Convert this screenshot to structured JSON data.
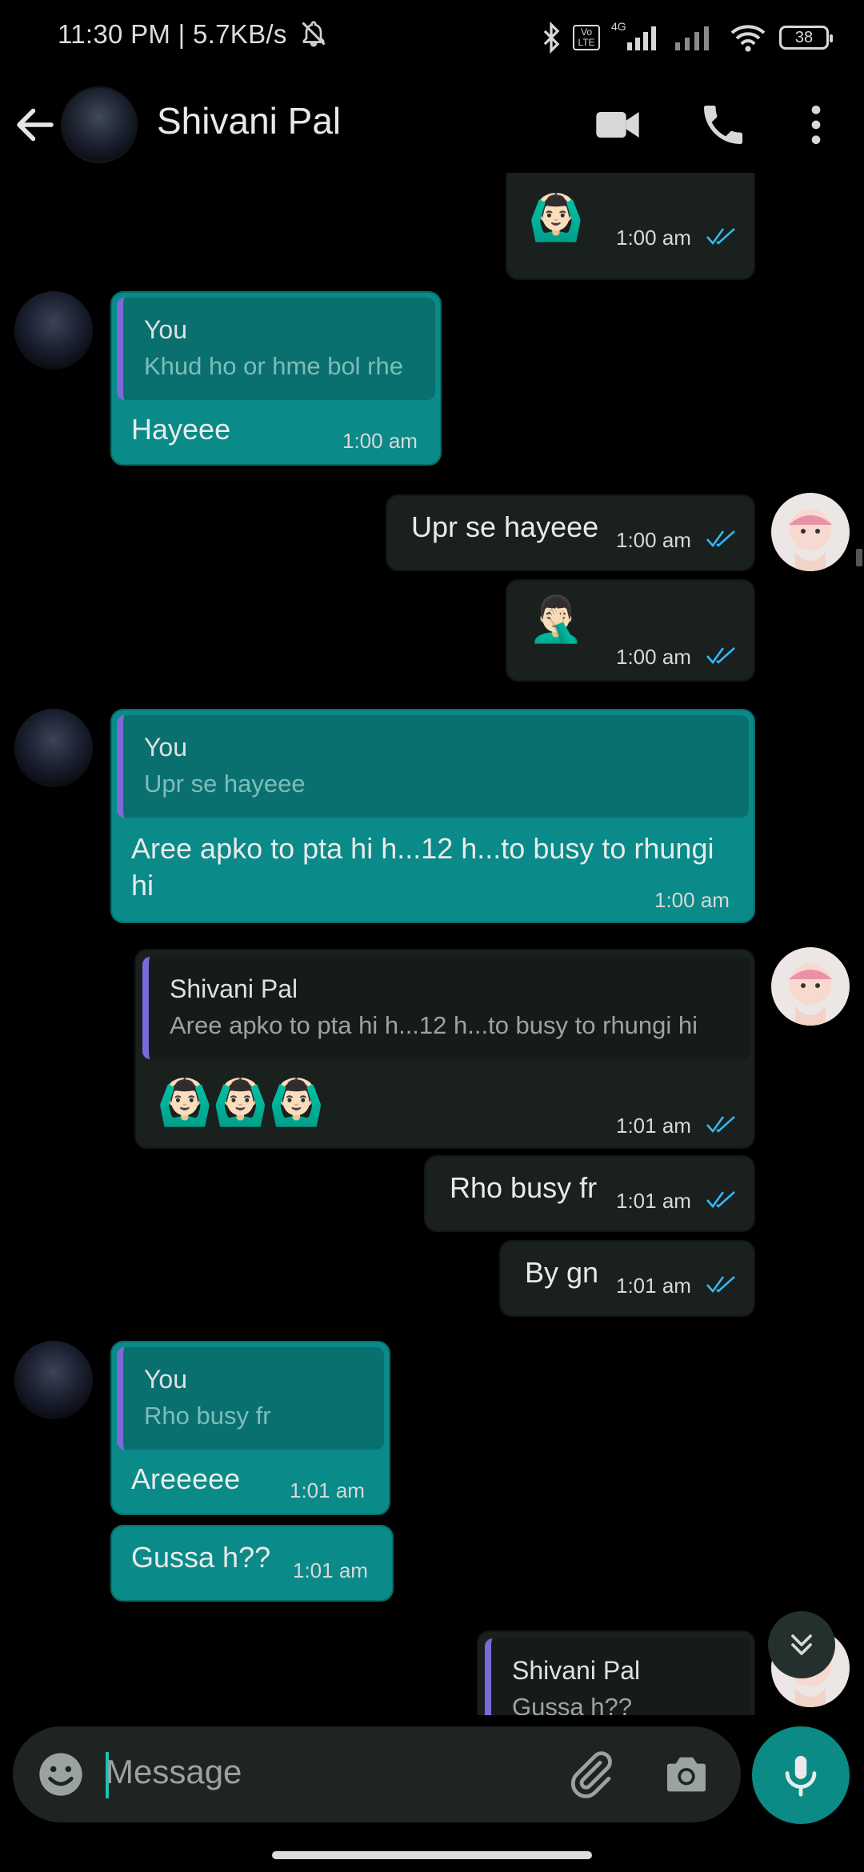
{
  "status_bar": {
    "time_speed": "11:30 PM | 5.7KB/s",
    "network": "4G",
    "volte": "Vo LTE",
    "battery": "38"
  },
  "header": {
    "contact_name": "Shivani Pal"
  },
  "messages": {
    "m1": {
      "time": "1:00 am"
    },
    "m2": {
      "quote_author": "You",
      "quote_text": "Khud ho or hme bol rhe",
      "text": "Hayeee",
      "time": "1:00 am"
    },
    "m3": {
      "text": "Upr se hayeee",
      "time": "1:00 am"
    },
    "m4": {
      "time": "1:00 am"
    },
    "m5": {
      "quote_author": "You",
      "quote_text": "Upr se hayeee",
      "text_line1": "Aree apko to pta hi h...12 h...to busy to rhungi",
      "text_line2": "hi",
      "time": "1:00 am"
    },
    "m6": {
      "quote_author": "Shivani Pal",
      "quote_text": "Aree apko to pta hi h...12 h...to busy to rhungi hi",
      "time": "1:01 am"
    },
    "m7": {
      "text": "Rho busy fr",
      "time": "1:01 am"
    },
    "m8": {
      "text": "By gn",
      "time": "1:01 am"
    },
    "m9": {
      "quote_author": "You",
      "quote_text": "Rho busy fr",
      "text": "Areeeee",
      "time": "1:01 am"
    },
    "m10": {
      "text": "Gussa h??",
      "time": "1:01 am"
    },
    "m11": {
      "quote_author": "Shivani Pal",
      "quote_text": "Gussa h??"
    }
  },
  "input": {
    "placeholder": "Message"
  },
  "colors": {
    "incoming_bubble": "#0a8a89",
    "outgoing_bubble": "#1a201e",
    "quote_bar": "#7b6ad8",
    "read_ticks": "#34b7f1",
    "mic_button": "#0b8a86"
  },
  "icons": [
    "back-arrow-icon",
    "video-call-icon",
    "phone-icon",
    "more-vert-icon",
    "emoji-icon",
    "attach-icon",
    "camera-icon",
    "mic-icon",
    "scroll-down-icon"
  ]
}
